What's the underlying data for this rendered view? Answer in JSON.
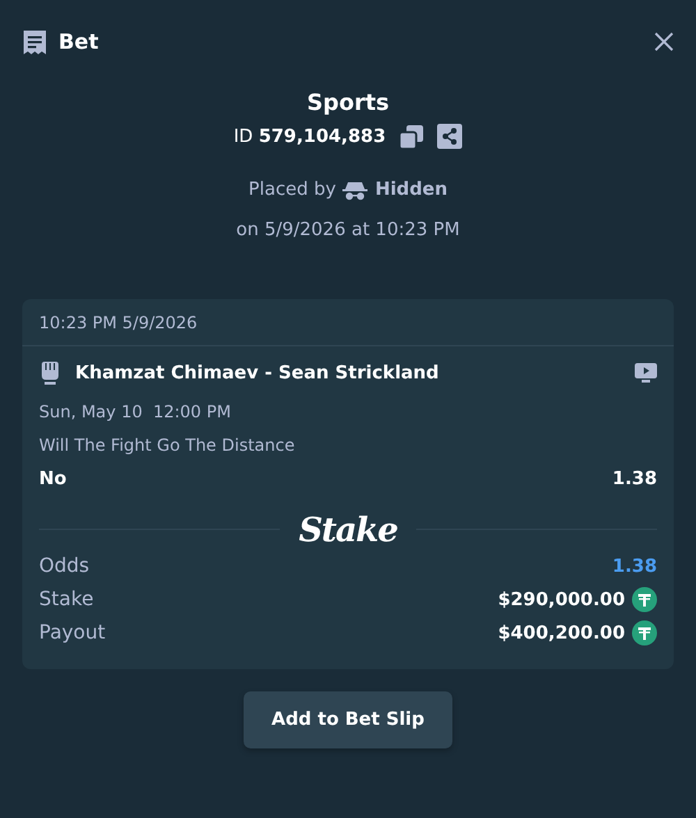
{
  "header": {
    "title": "Bet"
  },
  "summary": {
    "category": "Sports",
    "id_label": "ID",
    "id_value": "579,104,883",
    "placed_by_label": "Placed by",
    "placed_by_user": "Hidden",
    "placed_on": "on 5/9/2026 at 10:23 PM"
  },
  "card": {
    "timestamp": "10:23 PM 5/9/2026",
    "event": "Khamzat Chimaev - Sean Strickland",
    "event_time": "Sun, May 10  12:00 PM",
    "market": "Will The Fight Go The Distance",
    "selection": "No",
    "selection_odds": "1.38",
    "brand": "Stake",
    "rows": [
      {
        "label": "Odds",
        "value": "1.38",
        "kind": "odds"
      },
      {
        "label": "Stake",
        "value": "$290,000.00",
        "kind": "amount"
      },
      {
        "label": "Payout",
        "value": "$400,200.00",
        "kind": "amount"
      }
    ]
  },
  "button": {
    "label": "Add to Bet Slip"
  }
}
